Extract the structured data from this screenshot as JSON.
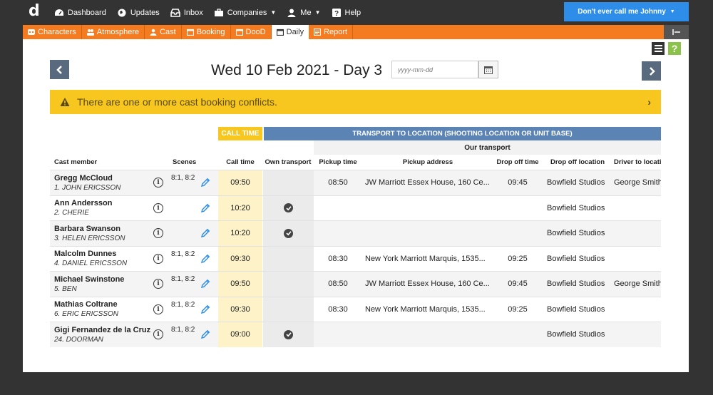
{
  "app": {
    "logo": "d",
    "nav": [
      {
        "label": "Dashboard",
        "icon": "dashboard-icon"
      },
      {
        "label": "Updates",
        "icon": "globe-icon"
      },
      {
        "label": "Inbox",
        "icon": "inbox-icon"
      },
      {
        "label": "Companies",
        "icon": "briefcase-icon",
        "dropdown": true
      },
      {
        "label": "Me",
        "icon": "user-icon",
        "dropdown": true
      },
      {
        "label": "Help",
        "icon": "help-icon"
      }
    ],
    "user_button": "Don't ever call me Johnny"
  },
  "tabs": [
    {
      "label": "Characters",
      "icon": "characters-icon",
      "active": false
    },
    {
      "label": "Atmosphere",
      "icon": "people-icon",
      "active": false
    },
    {
      "label": "Cast",
      "icon": "cast-icon",
      "active": false
    },
    {
      "label": "Booking",
      "icon": "calendar-icon",
      "active": false
    },
    {
      "label": "DooD",
      "icon": "calendar-icon",
      "active": false
    },
    {
      "label": "Daily",
      "icon": "calendar-icon",
      "active": true
    },
    {
      "label": "Report",
      "icon": "report-icon",
      "active": false
    }
  ],
  "page": {
    "title": "Wed 10 Feb 2021 - Day 3",
    "date_placeholder": "yyyy-mm-dd",
    "alert": "There are one or more cast booking conflicts."
  },
  "table": {
    "group_headers": {
      "call_time": "CALL TIME",
      "transport": "TRANSPORT TO LOCATION (SHOOTING LOCATION OR UNIT BASE)",
      "our_transport": "Our transport"
    },
    "columns": {
      "cast_member": "Cast member",
      "scenes": "Scenes",
      "call_time": "Call time",
      "own_transport": "Own transport",
      "pickup_time": "Pickup time",
      "pickup_address": "Pickup address",
      "drop_off_time": "Drop off time",
      "drop_off_location": "Drop off location",
      "driver": "Driver to locati"
    },
    "rows": [
      {
        "name": "Gregg McCloud",
        "role": "1. JOHN ERICSSON",
        "scenes": "8:1, 8:2",
        "call_time": "09:50",
        "own_transport": false,
        "pickup_time": "08:50",
        "pickup_address": "JW Marriott Essex House, 160 Ce...",
        "drop_off_time": "09:45",
        "drop_off_location": "Bowfield Studios",
        "driver": "George Smith"
      },
      {
        "name": "Ann Andersson",
        "role": "2. CHERIE",
        "scenes": "",
        "call_time": "10:20",
        "own_transport": true,
        "pickup_time": "",
        "pickup_address": "",
        "drop_off_time": "",
        "drop_off_location": "Bowfield Studios",
        "driver": ""
      },
      {
        "name": "Barbara Swanson",
        "role": "3. HELEN ERICSSON",
        "scenes": "",
        "call_time": "10:20",
        "own_transport": true,
        "pickup_time": "",
        "pickup_address": "",
        "drop_off_time": "",
        "drop_off_location": "Bowfield Studios",
        "driver": ""
      },
      {
        "name": "Malcolm Dunnes",
        "role": "4. DANIEL ERICSSON",
        "scenes": "8:1, 8:2",
        "call_time": "09:30",
        "own_transport": false,
        "pickup_time": "08:30",
        "pickup_address": "New York Marriott Marquis, 1535...",
        "drop_off_time": "09:25",
        "drop_off_location": "Bowfield Studios",
        "driver": ""
      },
      {
        "name": "Michael Swinstone",
        "role": "5. BEN",
        "scenes": "8:1, 8:2",
        "call_time": "09:50",
        "own_transport": false,
        "pickup_time": "08:50",
        "pickup_address": "JW Marriott Essex House, 160 Ce...",
        "drop_off_time": "09:45",
        "drop_off_location": "Bowfield Studios",
        "driver": "George Smith"
      },
      {
        "name": "Mathias Coltrane",
        "role": "6. ERIC ERICSSON",
        "scenes": "8:1, 8:2",
        "call_time": "09:30",
        "own_transport": false,
        "pickup_time": "08:30",
        "pickup_address": "New York Marriott Marquis, 1535...",
        "drop_off_time": "09:25",
        "drop_off_location": "Bowfield Studios",
        "driver": ""
      },
      {
        "name": "Gigi Fernandez de la Cruz",
        "role": "24. DOORMAN",
        "scenes": "8:1, 8:2",
        "call_time": "09:00",
        "own_transport": true,
        "pickup_time": "",
        "pickup_address": "",
        "drop_off_time": "",
        "drop_off_location": "Bowfield Studios",
        "driver": ""
      }
    ]
  },
  "colors": {
    "orange": "#f47b20",
    "accent_blue": "#2d8de8",
    "alert_yellow": "#f7c71f",
    "transport_blue": "#5b84b4",
    "call_time_bg": "#fdf2c8"
  }
}
